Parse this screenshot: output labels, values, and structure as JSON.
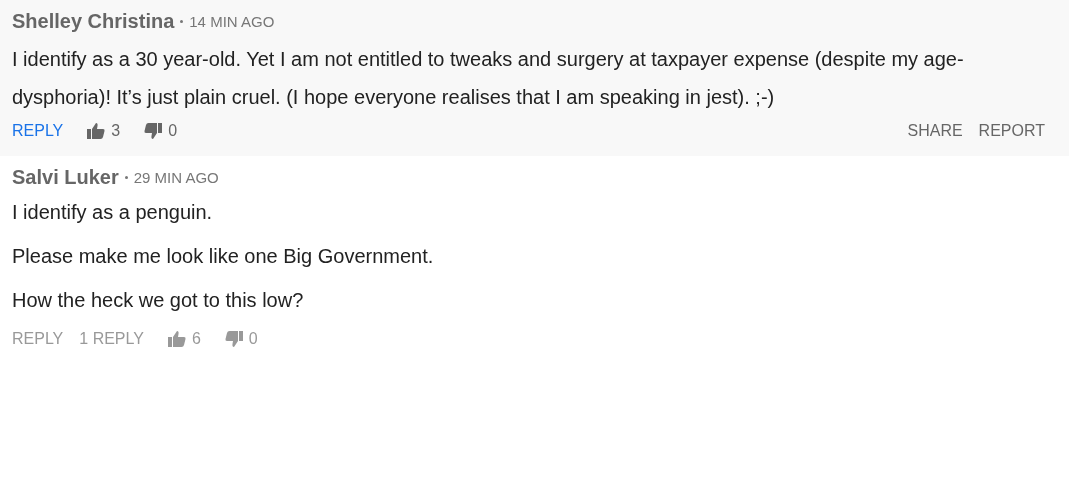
{
  "comments": [
    {
      "author": "Shelley Christina",
      "time": "14 MIN AGO",
      "highlighted": true,
      "paragraphs": [
        "I identify as a 30 year-old. Yet I am not entitled to tweaks and surgery at taxpayer expense (despite my age-dysphoria)! It’s just plain cruel. (I hope everyone realises that I am speaking in jest). ;-)"
      ],
      "reply": "REPLY",
      "likes": "3",
      "dislikes": "0",
      "share": "SHARE",
      "report": "REPORT"
    },
    {
      "author": "Salvi Luker",
      "time": "29 MIN AGO",
      "highlighted": false,
      "paragraphs": [
        "I identify as a penguin.",
        "Please make me look like one Big Government.",
        "How the heck we got to this low?"
      ],
      "reply": "REPLY",
      "replies": "1 REPLY",
      "likes": "6",
      "dislikes": "0"
    }
  ]
}
